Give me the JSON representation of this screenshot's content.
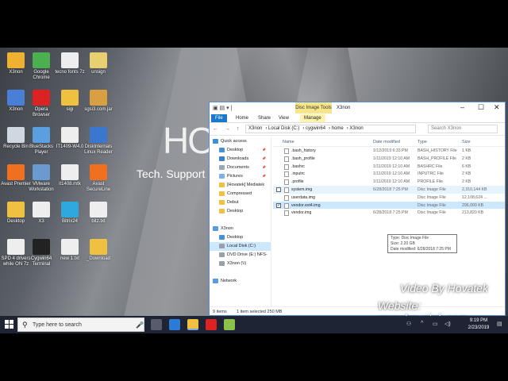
{
  "desktop": {
    "brand": "HO",
    "tagline": "Tech. Support",
    "icons": [
      {
        "label": "X3non",
        "color": "#f0b030"
      },
      {
        "label": "Google Chrome",
        "color": "#4caf50"
      },
      {
        "label": "tecno fonts 7z",
        "color": "#eeeeee"
      },
      {
        "label": "unsign",
        "color": "#e8d070"
      },
      {
        "label": "X3non",
        "color": "#4a7fd8"
      },
      {
        "label": "Opera Browser",
        "color": "#d22"
      },
      {
        "label": "sigi",
        "color": "#f0c040"
      },
      {
        "label": "sgsi3.com.jar",
        "color": "#d8a040"
      },
      {
        "label": "Recycle Bin",
        "color": "#cfd8e0"
      },
      {
        "label": "BlueStacks Player",
        "color": "#5aa0e0"
      },
      {
        "label": "IT1409-W4.0",
        "color": "#eeeeee"
      },
      {
        "label": "DiskInternals Linux Reader",
        "color": "#3a78d0"
      },
      {
        "label": "Avast Premier",
        "color": "#f07020"
      },
      {
        "label": "VMware Workstation",
        "color": "#6a9ad0"
      },
      {
        "label": "it1408.mtk",
        "color": "#eeeeee"
      },
      {
        "label": "Avast SecureLine",
        "color": "#f07020"
      },
      {
        "label": "Desktop",
        "color": "#f0c040"
      },
      {
        "label": "X3",
        "color": "#eeeeee"
      },
      {
        "label": "Bitrix24",
        "color": "#2fa8e0"
      },
      {
        "label": "bitz.txt",
        "color": "#eeeeee"
      },
      {
        "label": "SPD 4 drivers while ON 7z",
        "color": "#eeeeee"
      },
      {
        "label": "Cygwin64 Terminal",
        "color": "#222222"
      },
      {
        "label": "new 1.txt",
        "color": "#eeeeee"
      },
      {
        "label": "_Download",
        "color": "#f0c040"
      }
    ]
  },
  "explorer": {
    "title": "X3non",
    "contextual_tab": "Disc Image Tools",
    "ribbon_tabs": {
      "file": "File",
      "home": "Home",
      "share": "Share",
      "view": "View",
      "manage": "Manage"
    },
    "window_controls": {
      "minimize": "–",
      "maximize": "☐",
      "close": "✕"
    },
    "nav_arrows": "← → ↑",
    "breadcrumb": {
      "c1": "X3non",
      "c2": "Local Disk (C:)",
      "c3": "cygwin64",
      "c4": "home",
      "c5": "X3non"
    },
    "search_placeholder": "Search X3non",
    "nav_pane": [
      {
        "label": "Quick access",
        "color": "#3b8ee0",
        "indent": 0
      },
      {
        "label": "Desktop",
        "color": "#4a90d9",
        "indent": 1,
        "pin": "📌"
      },
      {
        "label": "Downloads",
        "color": "#3a7fd0",
        "indent": 1,
        "pin": "📌"
      },
      {
        "label": "Documents",
        "color": "#9aa7b8",
        "indent": 1,
        "pin": "📌"
      },
      {
        "label": "Pictures",
        "color": "#7db0e8",
        "indent": 1,
        "pin": "📌"
      },
      {
        "label": "[Hovatek] Mediatek",
        "color": "#f0c040",
        "indent": 1
      },
      {
        "label": "Compressed",
        "color": "#f0c040",
        "indent": 1
      },
      {
        "label": "Debut",
        "color": "#f0c040",
        "indent": 1
      },
      {
        "label": "Desktop",
        "color": "#f0c040",
        "indent": 1
      },
      {
        "label": "",
        "color": "",
        "indent": 0
      },
      {
        "label": "X3non",
        "color": "#5a9ae0",
        "indent": 0
      },
      {
        "label": "Desktop",
        "color": "#4a90d9",
        "indent": 1
      },
      {
        "label": "Local Disk (C:)",
        "color": "#9aa0a8",
        "indent": 1,
        "selected": true
      },
      {
        "label": "DVD Drive (E:) NFS-",
        "color": "#9aa0a8",
        "indent": 1
      },
      {
        "label": "X3non (\\\\)",
        "color": "#9aa0a8",
        "indent": 1
      },
      {
        "label": "",
        "color": "",
        "indent": 0
      },
      {
        "label": "Network",
        "color": "#5a9ae0",
        "indent": 0
      }
    ],
    "columns": {
      "name": "Name",
      "date": "Date modified",
      "type": "Type",
      "size": "Size"
    },
    "files": [
      {
        "name": ".bash_history",
        "date": "1/12/2019 6:33 PM",
        "type": "BASH_HISTORY File",
        "size": "1 KB"
      },
      {
        "name": ".bash_profile",
        "date": "1/11/2019 12:10 AM",
        "type": "BASH_PROFILE File",
        "size": "2 KB"
      },
      {
        "name": ".bashrc",
        "date": "1/11/2019 12:10 AM",
        "type": "BASHRC File",
        "size": "6 KB"
      },
      {
        "name": ".inputrc",
        "date": "1/11/2019 12:10 AM",
        "type": "INPUTRC File",
        "size": "2 KB"
      },
      {
        "name": ".profile",
        "date": "1/11/2019 12:10 AM",
        "type": "PROFILE File",
        "size": "2 KB"
      },
      {
        "name": "system.img",
        "date": "6/28/2018 7:25 PM",
        "type": "Disc Image File",
        "size": "2,310,144 KB",
        "state": "hover"
      },
      {
        "name": "userdata.img",
        "date": "",
        "type": "Disc Image File",
        "size": "12,108,624 ..."
      },
      {
        "name": "vendor.ext4.img",
        "date": "",
        "type": "Disc Image File",
        "size": "296,000 KB",
        "state": "selected"
      },
      {
        "name": "vendor.img",
        "date": "6/28/2018 7:25 PM",
        "type": "Disc Image File",
        "size": "213,820 KB"
      }
    ],
    "tooltip": {
      "line1": "Type: Disc Image File",
      "line2": "Size: 2.20 GB",
      "line3": "Date modified: 6/28/2018 7:25 PM"
    },
    "status": {
      "items": "9 items",
      "selected": "1 item selected  250 MB"
    }
  },
  "watermark": {
    "line1": "Video By Hovatek",
    "line2": "Website: www.hovatek.com"
  },
  "taskbar": {
    "search_placeholder": "Type here to search",
    "apps": [
      {
        "name": "task-view-icon",
        "color": "#555c6a"
      },
      {
        "name": "edge-icon",
        "color": "#2b7ad6"
      },
      {
        "name": "file-explorer-icon",
        "color": "#f0c040",
        "active": true
      },
      {
        "name": "opera-icon",
        "color": "#d22"
      },
      {
        "name": "notepad-plus-icon",
        "color": "#8bc34a"
      }
    ],
    "time": "9:19 PM",
    "date": "2/23/2019"
  }
}
